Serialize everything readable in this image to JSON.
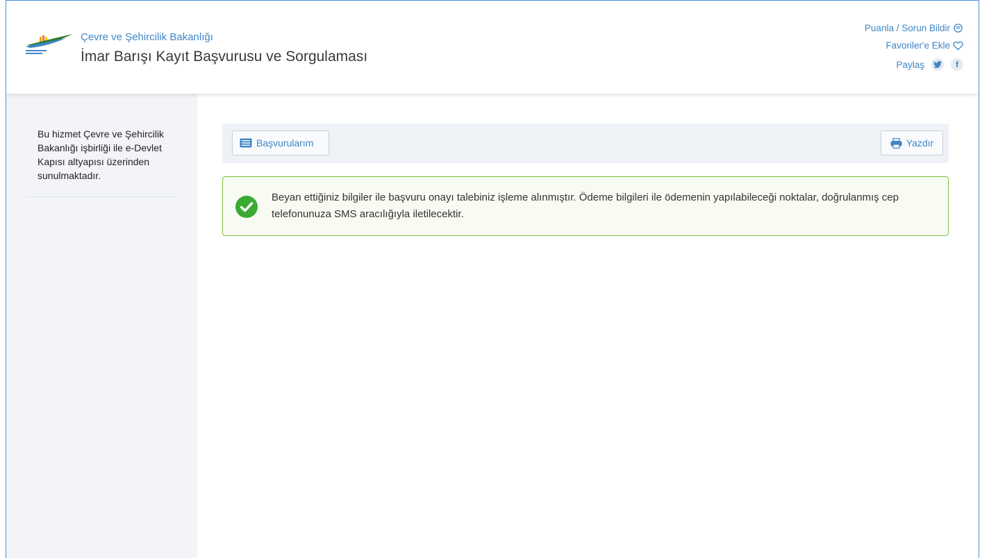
{
  "header": {
    "ministry": "Çevre ve Şehircilik Bakanlığı",
    "title": "İmar Barışı Kayıt Başvurusu ve Sorgulaması",
    "links": {
      "rate_report": "Puanla / Sorun Bildir",
      "add_favorites": "Favoriler'e Ekle",
      "share": "Paylaş"
    },
    "icons": [
      "comment-icon",
      "heart-icon",
      "twitter-icon",
      "facebook-icon"
    ]
  },
  "sidebar": {
    "note": "Bu hizmet Çevre ve Şehircilik Bakanlığı işbirliği ile e-Devlet Kapısı altyapısı üzerinden sunulmaktadır."
  },
  "toolbar": {
    "applications_label": "Başvurularım",
    "print_label": "Yazdır"
  },
  "alert": {
    "message": "Beyan ettiğiniz bilgiler ile başvuru onayı talebiniz işleme alınmıştır. Ödeme bilgileri ile ödemenin yapılabileceği noktalar, doğrulanmış cep telefonunuza SMS aracılığıyla iletilecektir.",
    "status_color": "#7cc242"
  },
  "colors": {
    "link": "#3f86c7",
    "sidebar_bg": "#f2f4f7",
    "success": "#3aaa35"
  }
}
